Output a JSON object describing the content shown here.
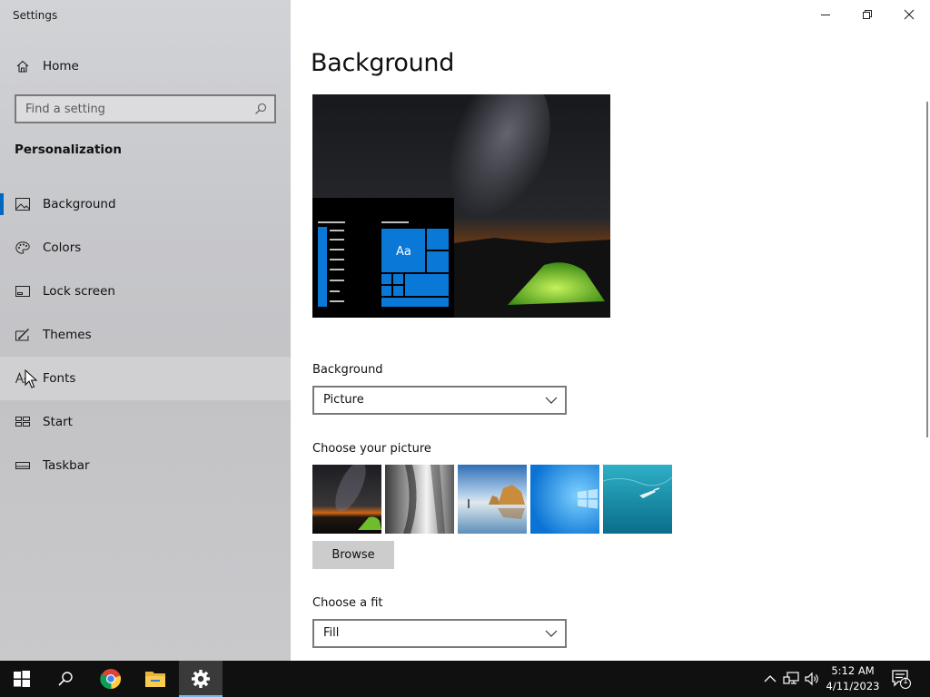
{
  "window": {
    "app_title": "Settings",
    "controls": [
      "minimize",
      "restore",
      "close"
    ]
  },
  "sidebar": {
    "home_label": "Home",
    "search_placeholder": "Find a setting",
    "section_title": "Personalization",
    "items": [
      {
        "label": "Background",
        "icon": "picture-icon",
        "selected": true
      },
      {
        "label": "Colors",
        "icon": "palette-icon"
      },
      {
        "label": "Lock screen",
        "icon": "lock-screen-icon"
      },
      {
        "label": "Themes",
        "icon": "themes-icon"
      },
      {
        "label": "Fonts",
        "icon": "fonts-icon",
        "hovered": true
      },
      {
        "label": "Start",
        "icon": "start-icon"
      },
      {
        "label": "Taskbar",
        "icon": "taskbar-icon"
      }
    ]
  },
  "main": {
    "title": "Background",
    "preview_tile_text": "Aa",
    "background": {
      "label": "Background",
      "value": "Picture"
    },
    "choose_picture": {
      "label": "Choose your picture",
      "thumbnails": [
        "night-sky-tent",
        "rock-cliff",
        "beach-rocks",
        "windows-blue",
        "underwater-swimmer"
      ]
    },
    "browse_label": "Browse",
    "fit": {
      "label": "Choose a fit",
      "value": "Fill"
    }
  },
  "taskbar": {
    "apps": [
      "start-button",
      "search-button",
      "chrome",
      "file-explorer",
      "settings"
    ],
    "time": "5:12 AM",
    "date": "4/11/2023",
    "notification_count": "1"
  },
  "colors": {
    "accent": "#0067c0",
    "tile_blue": "#0a78d7",
    "taskbar": "#101010"
  }
}
